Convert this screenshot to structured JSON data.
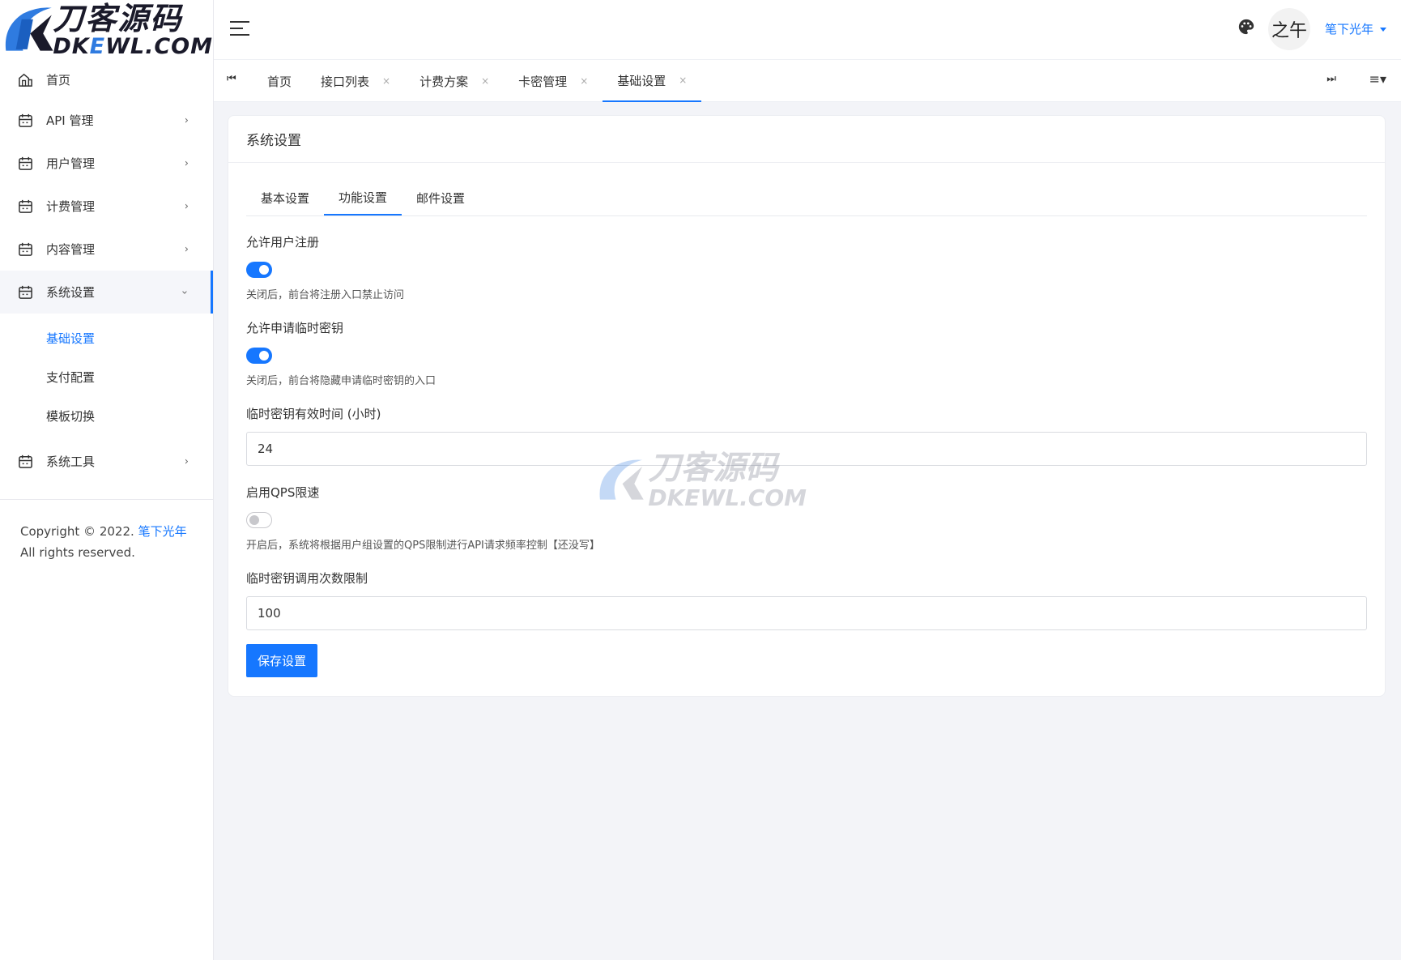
{
  "logo": {
    "cn": "刀客源码",
    "en_prefix": "DK",
    "en_hl": "E",
    "en_suffix": "WL.COM"
  },
  "sidebar": {
    "items": [
      {
        "label": "首页",
        "icon": "home-icon"
      },
      {
        "label": "API 管理",
        "icon": "calendar-icon"
      },
      {
        "label": "用户管理",
        "icon": "calendar-icon"
      },
      {
        "label": "计费管理",
        "icon": "calendar-icon"
      },
      {
        "label": "内容管理",
        "icon": "calendar-icon"
      },
      {
        "label": "系统设置",
        "icon": "calendar-icon"
      },
      {
        "label": "系统工具",
        "icon": "calendar-icon"
      }
    ],
    "sub_items": [
      "基础设置",
      "支付配置",
      "模板切换"
    ],
    "copyright_prefix": "Copyright © 2022.",
    "copyright_link": "笔下光年",
    "copyright_suffix": "All rights reserved."
  },
  "header": {
    "avatar_text": "之午",
    "user_name": "笔下光年"
  },
  "tabs": [
    {
      "label": "首页"
    },
    {
      "label": "接口列表"
    },
    {
      "label": "计费方案"
    },
    {
      "label": "卡密管理"
    },
    {
      "label": "基础设置"
    }
  ],
  "card": {
    "title": "系统设置",
    "inner_tabs": [
      "基本设置",
      "功能设置",
      "邮件设置"
    ],
    "fields": {
      "allow_register": {
        "label": "允许用户注册",
        "enabled": true,
        "help": "关闭后，前台将注册入口禁止访问"
      },
      "allow_temp_key": {
        "label": "允许申请临时密钥",
        "enabled": true,
        "help": "关闭后，前台将隐藏申请临时密钥的入口"
      },
      "temp_key_hours": {
        "label": "临时密钥有效时间 (小时)",
        "value": "24"
      },
      "qps_limit": {
        "label": "启用QPS限速",
        "enabled": false,
        "help": "开启后，系统将根据用户组设置的QPS限制进行API请求频率控制【还没写】"
      },
      "temp_key_calls": {
        "label": "临时密钥调用次数限制",
        "value": "100"
      }
    },
    "save_label": "保存设置"
  },
  "colors": {
    "accent": "#1677ff",
    "background": "#f3f4f8"
  }
}
